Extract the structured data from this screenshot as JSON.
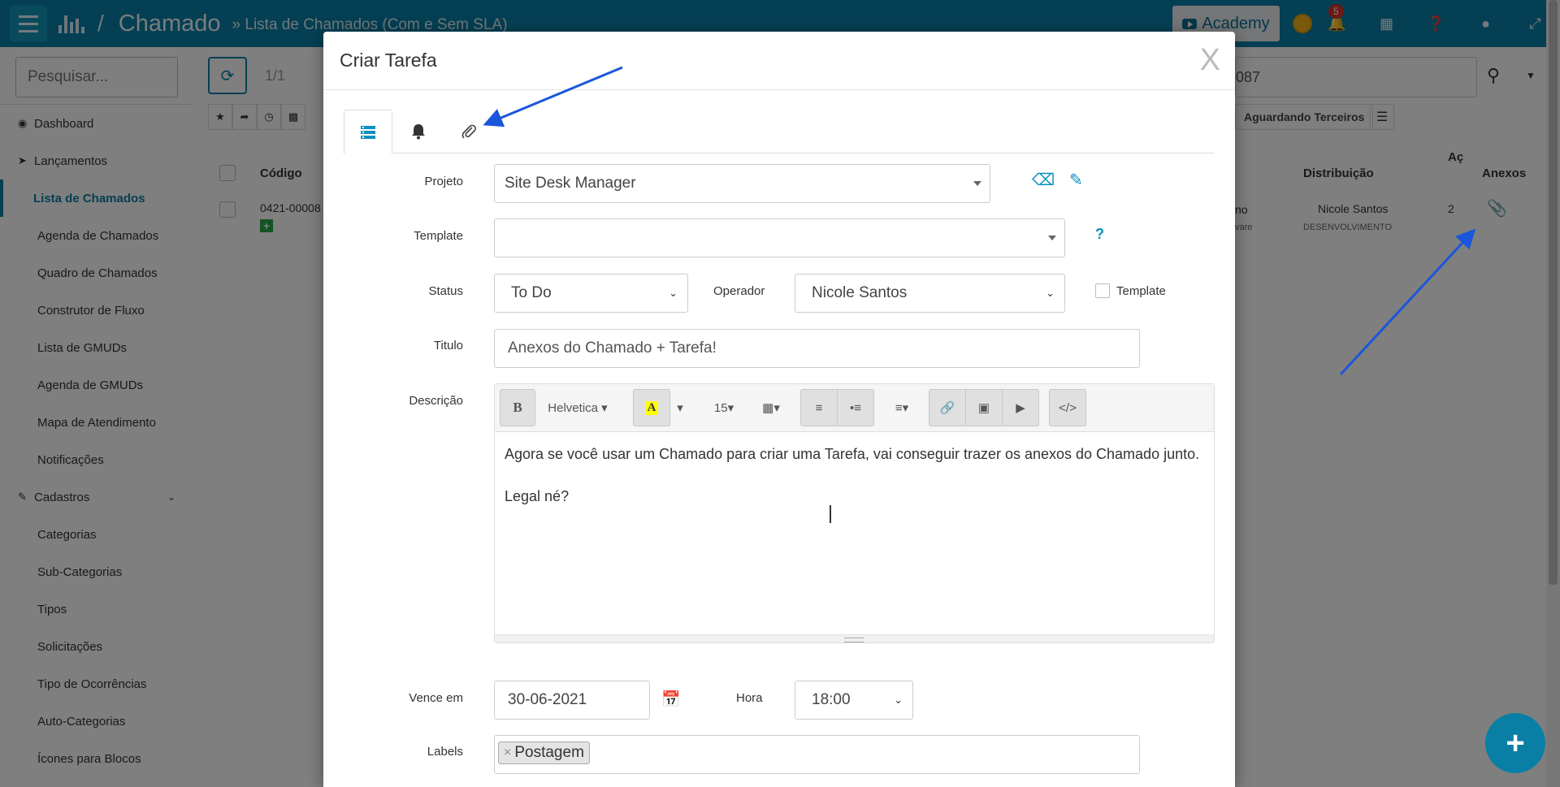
{
  "topbar": {
    "app_title": "Chamado",
    "breadcrumb": "» Lista de Chamados (Com e Sem SLA)",
    "academy_label": "Academy",
    "notifications_count": "5"
  },
  "sidebar": {
    "search_placeholder": "Pesquisar...",
    "items": [
      {
        "label": "Dashboard"
      },
      {
        "label": "Lançamentos"
      },
      {
        "label": "Lista de Chamados"
      },
      {
        "label": "Agenda de Chamados"
      },
      {
        "label": "Quadro de Chamados"
      },
      {
        "label": "Construtor de Fluxo"
      },
      {
        "label": "Lista de GMUDs"
      },
      {
        "label": "Agenda de GMUDs"
      },
      {
        "label": "Mapa de Atendimento"
      },
      {
        "label": "Notificações"
      },
      {
        "label": "Cadastros"
      },
      {
        "label": "Categorias"
      },
      {
        "label": "Sub-Categorias"
      },
      {
        "label": "Tipos"
      },
      {
        "label": "Solicitações"
      },
      {
        "label": "Tipo de Ocorrências"
      },
      {
        "label": "Auto-Categorias"
      },
      {
        "label": "Ícones para Blocos"
      }
    ]
  },
  "background": {
    "pager": "1/1",
    "search_value": "087",
    "filter_label": "Aguardando Terceiros",
    "columns": {
      "codigo": "Código",
      "distribuicao": "Distribuição",
      "acoes": "Aç",
      "anexos": "Anexos"
    },
    "row": {
      "codigo": "0421-00008",
      "status_fragment": "no",
      "status_sub_fragment": "vare",
      "distribuicao_name": "Nicole Santos",
      "distribuicao_team": "DESENVOLVIMENTO",
      "acoes_count": "2"
    }
  },
  "modal": {
    "title": "Criar Tarefa",
    "close_label": "X",
    "labels": {
      "projeto": "Projeto",
      "template": "Template",
      "status": "Status",
      "operador": "Operador",
      "template_check": "Template",
      "titulo": "Titulo",
      "descricao": "Descrição",
      "vence_em": "Vence em",
      "hora": "Hora",
      "labels": "Labels"
    },
    "values": {
      "projeto": "Site Desk Manager",
      "template": "",
      "status": "To Do",
      "operador": "Nicole Santos",
      "titulo": "Anexos do Chamado + Tarefa!",
      "vence_em": "30-06-2021",
      "hora": "18:00",
      "label_tag": "Postagem",
      "help_mark": "?"
    },
    "editor": {
      "font_name": "Helvetica",
      "font_size": "15",
      "line1": "Agora se você usar um Chamado para criar uma Tarefa, vai conseguir trazer os anexos do Chamado junto.",
      "line2": "Legal né?"
    }
  },
  "colors": {
    "brand": "#0a7fa6",
    "accent_icon": "#0a8fbf",
    "arrow": "#1a56db"
  }
}
